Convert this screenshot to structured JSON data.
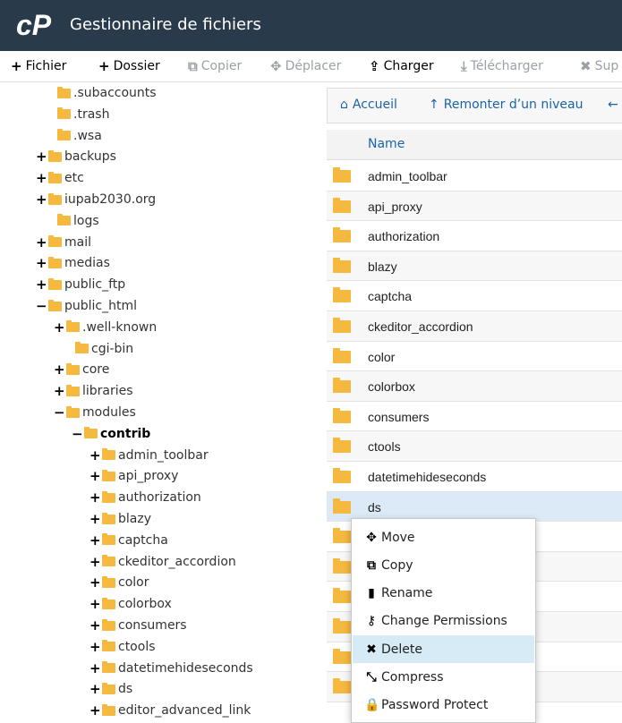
{
  "header": {
    "title": "Gestionnaire de fichiers",
    "logo_text": "cP"
  },
  "toolbar": {
    "items": [
      {
        "label": "Fichier",
        "icon": "plus-icon",
        "glyph": "+"
      },
      {
        "label": "Dossier",
        "icon": "plus-icon",
        "glyph": "+"
      },
      {
        "label": "Copier",
        "icon": "copy-icon",
        "glyph": "⧉"
      },
      {
        "label": "Déplacer",
        "icon": "move-icon",
        "glyph": "✥"
      },
      {
        "label": "Charger",
        "icon": "upload-icon",
        "glyph": "⇪"
      },
      {
        "label": "Télécharger",
        "icon": "download-icon",
        "glyph": "⤓"
      },
      {
        "label": "Sup",
        "icon": "delete-icon",
        "glyph": "✖"
      }
    ]
  },
  "tree": [
    {
      "toggle": "",
      "label": ".subaccounts"
    },
    {
      "toggle": "",
      "label": ".trash"
    },
    {
      "toggle": "",
      "label": ".wsa"
    },
    {
      "toggle": "+",
      "label": "backups"
    },
    {
      "toggle": "+",
      "label": "etc"
    },
    {
      "toggle": "+",
      "label": "iupab2030.org"
    },
    {
      "toggle": "",
      "label": "logs"
    },
    {
      "toggle": "+",
      "label": "mail"
    },
    {
      "toggle": "+",
      "label": "medias"
    },
    {
      "toggle": "+",
      "label": "public_ftp"
    },
    {
      "toggle": "−",
      "label": "public_html"
    },
    {
      "toggle": "+",
      "label": ".well-known"
    },
    {
      "toggle": "",
      "label": "cgi-bin"
    },
    {
      "toggle": "+",
      "label": "core"
    },
    {
      "toggle": "+",
      "label": "libraries"
    },
    {
      "toggle": "−",
      "label": "modules"
    },
    {
      "toggle": "−",
      "label": "contrib"
    },
    {
      "toggle": "+",
      "label": "admin_toolbar"
    },
    {
      "toggle": "+",
      "label": "api_proxy"
    },
    {
      "toggle": "+",
      "label": "authorization"
    },
    {
      "toggle": "+",
      "label": "blazy"
    },
    {
      "toggle": "+",
      "label": "captcha"
    },
    {
      "toggle": "+",
      "label": "ckeditor_accordion"
    },
    {
      "toggle": "+",
      "label": "color"
    },
    {
      "toggle": "+",
      "label": "colorbox"
    },
    {
      "toggle": "+",
      "label": "consumers"
    },
    {
      "toggle": "+",
      "label": "ctools"
    },
    {
      "toggle": "+",
      "label": "datetimehideseconds"
    },
    {
      "toggle": "+",
      "label": "ds"
    },
    {
      "toggle": "+",
      "label": "editor_advanced_link"
    }
  ],
  "nav": {
    "home_label": "Accueil",
    "up_label": "Remonter d’un niveau",
    "back_glyph": "←"
  },
  "table": {
    "column_name": "Name",
    "rows": [
      "admin_toolbar",
      "api_proxy",
      "authorization",
      "blazy",
      "captcha",
      "ckeditor_accordion",
      "color",
      "colorbox",
      "consumers",
      "ctools",
      "datetimehideseconds",
      "ds",
      "",
      "",
      "",
      "",
      "",
      ""
    ]
  },
  "context_menu": {
    "items": [
      {
        "label": "Move",
        "icon": "move-icon",
        "glyph": "✥"
      },
      {
        "label": "Copy",
        "icon": "copy-icon",
        "glyph": "⧉"
      },
      {
        "label": "Rename",
        "icon": "file-icon",
        "glyph": "▮"
      },
      {
        "label": "Change Permissions",
        "icon": "key-icon",
        "glyph": "⚷"
      },
      {
        "label": "Delete",
        "icon": "delete-icon",
        "glyph": "✖"
      },
      {
        "label": "Compress",
        "icon": "compress-icon",
        "glyph": "⤡"
      },
      {
        "label": "Password Protect",
        "icon": "lock-icon",
        "glyph": "🔒"
      }
    ]
  },
  "colors": {
    "header_bg": "#293a4a",
    "folder": "#f4b93e",
    "link": "#1a63a8",
    "selected_row": "#dbeaf6"
  }
}
